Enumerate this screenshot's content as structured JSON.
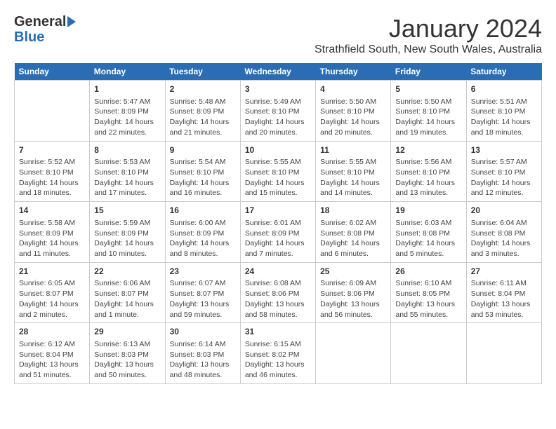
{
  "header": {
    "logo_general": "General",
    "logo_blue": "Blue",
    "month_title": "January 2024",
    "location": "Strathfield South, New South Wales, Australia"
  },
  "weekdays": [
    "Sunday",
    "Monday",
    "Tuesday",
    "Wednesday",
    "Thursday",
    "Friday",
    "Saturday"
  ],
  "weeks": [
    [
      {
        "day": "",
        "info": ""
      },
      {
        "day": "1",
        "info": "Sunrise: 5:47 AM\nSunset: 8:09 PM\nDaylight: 14 hours\nand 22 minutes."
      },
      {
        "day": "2",
        "info": "Sunrise: 5:48 AM\nSunset: 8:09 PM\nDaylight: 14 hours\nand 21 minutes."
      },
      {
        "day": "3",
        "info": "Sunrise: 5:49 AM\nSunset: 8:10 PM\nDaylight: 14 hours\nand 20 minutes."
      },
      {
        "day": "4",
        "info": "Sunrise: 5:50 AM\nSunset: 8:10 PM\nDaylight: 14 hours\nand 20 minutes."
      },
      {
        "day": "5",
        "info": "Sunrise: 5:50 AM\nSunset: 8:10 PM\nDaylight: 14 hours\nand 19 minutes."
      },
      {
        "day": "6",
        "info": "Sunrise: 5:51 AM\nSunset: 8:10 PM\nDaylight: 14 hours\nand 18 minutes."
      }
    ],
    [
      {
        "day": "7",
        "info": "Sunrise: 5:52 AM\nSunset: 8:10 PM\nDaylight: 14 hours\nand 18 minutes."
      },
      {
        "day": "8",
        "info": "Sunrise: 5:53 AM\nSunset: 8:10 PM\nDaylight: 14 hours\nand 17 minutes."
      },
      {
        "day": "9",
        "info": "Sunrise: 5:54 AM\nSunset: 8:10 PM\nDaylight: 14 hours\nand 16 minutes."
      },
      {
        "day": "10",
        "info": "Sunrise: 5:55 AM\nSunset: 8:10 PM\nDaylight: 14 hours\nand 15 minutes."
      },
      {
        "day": "11",
        "info": "Sunrise: 5:55 AM\nSunset: 8:10 PM\nDaylight: 14 hours\nand 14 minutes."
      },
      {
        "day": "12",
        "info": "Sunrise: 5:56 AM\nSunset: 8:10 PM\nDaylight: 14 hours\nand 13 minutes."
      },
      {
        "day": "13",
        "info": "Sunrise: 5:57 AM\nSunset: 8:10 PM\nDaylight: 14 hours\nand 12 minutes."
      }
    ],
    [
      {
        "day": "14",
        "info": "Sunrise: 5:58 AM\nSunset: 8:09 PM\nDaylight: 14 hours\nand 11 minutes."
      },
      {
        "day": "15",
        "info": "Sunrise: 5:59 AM\nSunset: 8:09 PM\nDaylight: 14 hours\nand 10 minutes."
      },
      {
        "day": "16",
        "info": "Sunrise: 6:00 AM\nSunset: 8:09 PM\nDaylight: 14 hours\nand 8 minutes."
      },
      {
        "day": "17",
        "info": "Sunrise: 6:01 AM\nSunset: 8:09 PM\nDaylight: 14 hours\nand 7 minutes."
      },
      {
        "day": "18",
        "info": "Sunrise: 6:02 AM\nSunset: 8:08 PM\nDaylight: 14 hours\nand 6 minutes."
      },
      {
        "day": "19",
        "info": "Sunrise: 6:03 AM\nSunset: 8:08 PM\nDaylight: 14 hours\nand 5 minutes."
      },
      {
        "day": "20",
        "info": "Sunrise: 6:04 AM\nSunset: 8:08 PM\nDaylight: 14 hours\nand 3 minutes."
      }
    ],
    [
      {
        "day": "21",
        "info": "Sunrise: 6:05 AM\nSunset: 8:07 PM\nDaylight: 14 hours\nand 2 minutes."
      },
      {
        "day": "22",
        "info": "Sunrise: 6:06 AM\nSunset: 8:07 PM\nDaylight: 14 hours\nand 1 minute."
      },
      {
        "day": "23",
        "info": "Sunrise: 6:07 AM\nSunset: 8:07 PM\nDaylight: 13 hours\nand 59 minutes."
      },
      {
        "day": "24",
        "info": "Sunrise: 6:08 AM\nSunset: 8:06 PM\nDaylight: 13 hours\nand 58 minutes."
      },
      {
        "day": "25",
        "info": "Sunrise: 6:09 AM\nSunset: 8:06 PM\nDaylight: 13 hours\nand 56 minutes."
      },
      {
        "day": "26",
        "info": "Sunrise: 6:10 AM\nSunset: 8:05 PM\nDaylight: 13 hours\nand 55 minutes."
      },
      {
        "day": "27",
        "info": "Sunrise: 6:11 AM\nSunset: 8:04 PM\nDaylight: 13 hours\nand 53 minutes."
      }
    ],
    [
      {
        "day": "28",
        "info": "Sunrise: 6:12 AM\nSunset: 8:04 PM\nDaylight: 13 hours\nand 51 minutes."
      },
      {
        "day": "29",
        "info": "Sunrise: 6:13 AM\nSunset: 8:03 PM\nDaylight: 13 hours\nand 50 minutes."
      },
      {
        "day": "30",
        "info": "Sunrise: 6:14 AM\nSunset: 8:03 PM\nDaylight: 13 hours\nand 48 minutes."
      },
      {
        "day": "31",
        "info": "Sunrise: 6:15 AM\nSunset: 8:02 PM\nDaylight: 13 hours\nand 46 minutes."
      },
      {
        "day": "",
        "info": ""
      },
      {
        "day": "",
        "info": ""
      },
      {
        "day": "",
        "info": ""
      }
    ]
  ]
}
